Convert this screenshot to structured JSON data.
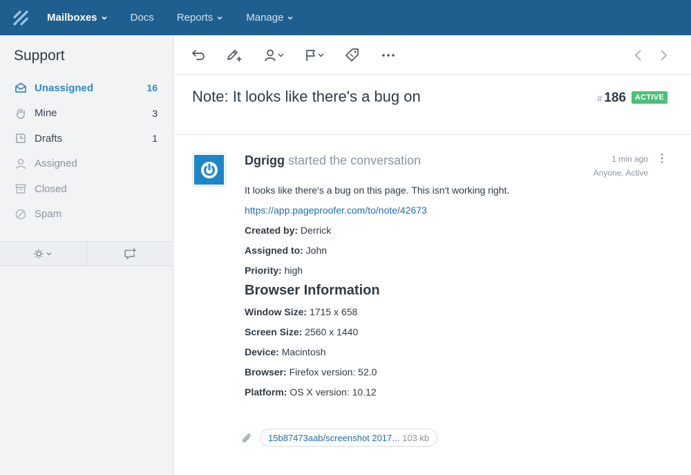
{
  "nav": {
    "items": [
      {
        "label": "Mailboxes",
        "active": true
      },
      {
        "label": "Docs"
      },
      {
        "label": "Reports"
      },
      {
        "label": "Manage"
      }
    ]
  },
  "sidebar": {
    "title": "Support",
    "items": [
      {
        "label": "Unassigned",
        "count": "16",
        "icon": "inbox-icon"
      },
      {
        "label": "Mine",
        "count": "3",
        "icon": "hand-icon"
      },
      {
        "label": "Drafts",
        "count": "1",
        "icon": "drafts-icon"
      },
      {
        "label": "Assigned",
        "count": "",
        "icon": "user-icon"
      },
      {
        "label": "Closed",
        "count": "",
        "icon": "archive-icon"
      },
      {
        "label": "Spam",
        "count": "",
        "icon": "spam-icon"
      }
    ]
  },
  "conversation": {
    "subject": "Note: It looks like there's a bug on",
    "number_prefix": "#",
    "number": "186",
    "status": "ACTIVE",
    "author": "Dgrigg",
    "action": "started the conversation",
    "time": "1 min ago",
    "meta": "Anyone, Active",
    "body": {
      "intro": "It looks like there's a bug on this page. This isn't working right.",
      "link": "https://app.pageproofer.com/to/note/42673",
      "created_by_label": "Created by:",
      "created_by": "Derrick",
      "assigned_to_label": "Assigned to:",
      "assigned_to": "John",
      "priority_label": "Priority:",
      "priority": "high",
      "section_title": "Browser Information",
      "window_size_label": "Window Size:",
      "window_size": "1715 x 658",
      "screen_size_label": "Screen Size:",
      "screen_size": "2560 x 1440",
      "device_label": "Device:",
      "device": "Macintosh",
      "browser_label": "Browser:",
      "browser": "Firefox version: 52.0",
      "platform_label": "Platform:",
      "platform": "OS X version: 10.12"
    },
    "attachment": {
      "name": "15b87473aab/screenshot 2017...",
      "size": "103 kb"
    }
  },
  "colors": {
    "topbar": "#1f5f8f",
    "accent": "#2d8bc7",
    "status_active": "#4bc07a"
  }
}
